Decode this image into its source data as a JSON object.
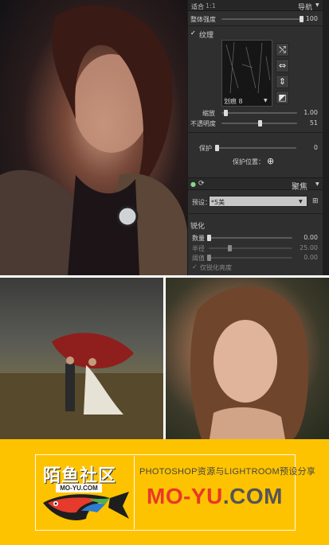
{
  "panel": {
    "header": {
      "left_label": "适合",
      "ratio": "1:1",
      "nav_label": "导航",
      "arrow_glyph": "▼"
    },
    "overall": {
      "label": "整体强度",
      "value": "100",
      "fraction": 1.0
    },
    "texture": {
      "check_glyph": "✓",
      "label": "纹理",
      "preset_label": "划痕 8",
      "dropdown_glyph": "▼",
      "buttons": [
        {
          "name": "shuffle-icon",
          "glyph": "⤭"
        },
        {
          "name": "flip-horizontal-icon",
          "glyph": "⇔"
        },
        {
          "name": "flip-vertical-icon",
          "glyph": "⇕"
        },
        {
          "name": "invert-icon",
          "glyph": "◩"
        }
      ],
      "scale": {
        "label": "缩放",
        "value": "1.00",
        "fraction": 0.05
      },
      "opacity": {
        "label": "不透明度",
        "value": "51",
        "fraction": 0.51
      }
    },
    "protect": {
      "label": "保护",
      "value": "0",
      "fraction": 0.0,
      "position_label": "保护位置：",
      "target_glyph": "⊕"
    },
    "focus": {
      "toggle_glyph": "●",
      "reset_glyph": "⟳",
      "label": "聚焦",
      "arrow_glyph": "▼"
    },
    "preset": {
      "label": "预设：",
      "value": "*5美",
      "dropdown_glyph": "▼",
      "side_glyph": "⊞"
    },
    "sharpen": {
      "label": "锐化",
      "amount": {
        "label": "数量",
        "value": "0.00",
        "fraction": 0.0
      },
      "radius": {
        "label": "半径",
        "value": "25.00",
        "fraction": 0.25
      },
      "threshold": {
        "label": "阈值",
        "value": "0.00",
        "fraction": 0.0
      },
      "checkbox_glyph": "✓",
      "checkbox_label": "仅锐化亮度"
    }
  },
  "banner": {
    "logo_cn": "陌鱼社区",
    "logo_sub": "MO-YU.COM",
    "tagline": "PHOTOSHOP资源与LIGHTROOM预设分享",
    "site_part1": "MO-YU",
    "site_part2": ".COM"
  },
  "colors": {
    "banner_bg": "#fec300",
    "site_red": "#e8382b",
    "site_gray": "#555555",
    "panel_bg": "#2f2f2f"
  }
}
